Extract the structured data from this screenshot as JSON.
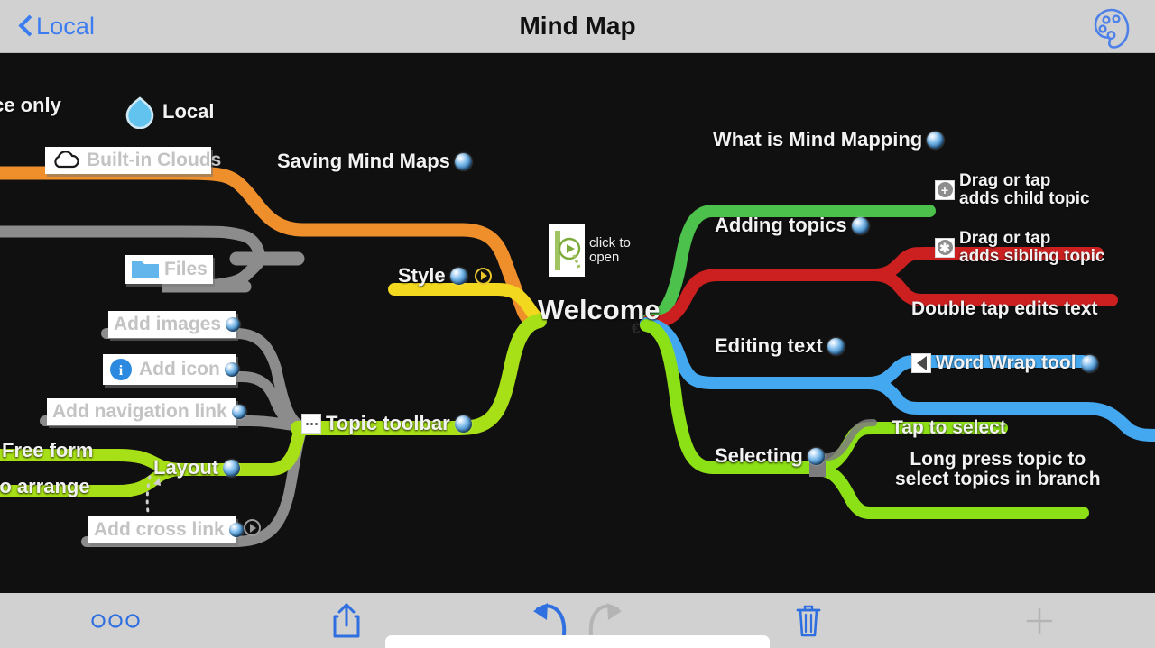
{
  "header": {
    "back_label": "Local",
    "title": "Mind Map",
    "back_icon": "chevron-left-icon",
    "palette_icon": "palette-icon",
    "bg_color": "#d1d1d1",
    "accent_color": "#3b7cf0"
  },
  "canvas": {
    "bg_color": "#111010",
    "center": {
      "label": "Welcome"
    },
    "attachment": {
      "label": "click to\nopen",
      "icon": "play-circle-icon"
    },
    "branches": [
      {
        "name": "Saving Mind Maps",
        "color": "#ef8f2b",
        "side": "left"
      },
      {
        "name": "Style",
        "color": "#f2d81e",
        "side": "left"
      },
      {
        "name": "Topic toolbar",
        "color": "#a8e017",
        "side": "left"
      },
      {
        "name": "Layout",
        "color": "#a8e017",
        "side": "left"
      },
      {
        "name": "What is Mind Mapping",
        "color": "#4cc14c",
        "side": "right"
      },
      {
        "name": "Adding topics",
        "color": "#cc1f1f",
        "side": "right"
      },
      {
        "name": "Editing text",
        "color": "#44a8f0",
        "side": "right"
      },
      {
        "name": "Selecting",
        "color": "#8ce016",
        "side": "right"
      }
    ],
    "nodes": {
      "device_only": "ce only",
      "local": "Local",
      "built_in_clouds": "Built-in Clouds",
      "files": "Files",
      "saving_mind_maps": "Saving Mind Maps",
      "style": "Style",
      "add_images": "Add images",
      "add_icon": "Add icon",
      "add_navigation_link": "Add navigation link",
      "topic_toolbar": "Topic toolbar",
      "free_form": "Free form",
      "to_arrange": "to arrange",
      "layout": "Layout",
      "add_cross_link": "Add cross link",
      "what_is_mind_mapping": "What is Mind Mapping",
      "drag_child": "Drag or tap\nadds child topic",
      "adding_topics": "Adding topics",
      "drag_sibling": "Drag or tap\nadds sibling topic",
      "double_tap": "Double tap edits text",
      "editing_text": "Editing text",
      "word_wrap": "Word Wrap tool",
      "tap_to_select": "Tap to select",
      "selecting": "Selecting",
      "long_press": "Long press topic to\nselect topics in branch"
    },
    "icons": {
      "local": "droplet-icon",
      "clouds": "cloud-icon",
      "files": "folder-icon",
      "add_icon": "info-circle-icon",
      "topic_toolbar": "three-dots-square-icon",
      "drag_child": "plus-circle-icon",
      "drag_sibling": "asterisk-circle-icon",
      "word_wrap": "triangle-left-icon",
      "style_play": "play-circle-icon",
      "cross_link_play": "play-circle-icon",
      "topic_marker": "globe-sphere-icon"
    }
  },
  "toolbar": {
    "items": [
      {
        "name": "more",
        "icon": "three-circles-icon",
        "enabled": true
      },
      {
        "name": "share",
        "icon": "share-icon",
        "enabled": true
      },
      {
        "name": "undo",
        "icon": "undo-arrow-icon",
        "enabled": true
      },
      {
        "name": "redo",
        "icon": "redo-arrow-icon",
        "enabled": false
      },
      {
        "name": "delete",
        "icon": "trash-icon",
        "enabled": true
      },
      {
        "name": "add",
        "icon": "plus-icon",
        "enabled": false
      }
    ],
    "bg_color": "#d1d1d1",
    "active_color": "#2f6fe0",
    "disabled_color": "#b0b0b0"
  }
}
